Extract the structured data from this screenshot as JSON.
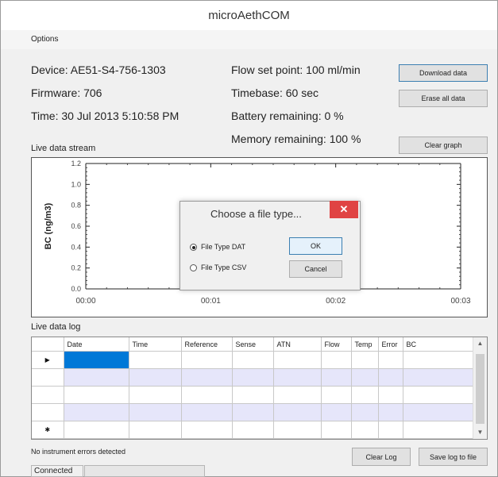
{
  "window": {
    "title": "microAethCOM"
  },
  "menu": {
    "options": "Options"
  },
  "info": {
    "device": "Device: AE51-S4-756-1303",
    "firmware": "Firmware: 706",
    "time": "Time: 30 Jul 2013 5:10:58 PM",
    "flow": "Flow set point: 100 ml/min",
    "timebase": "Timebase: 60 sec",
    "battery": "Battery remaining: 0 %",
    "memory": "Memory remaining: 100 %"
  },
  "buttons": {
    "download": "Download data",
    "erase": "Erase all data",
    "clear_graph": "Clear graph",
    "clear_log": "Clear Log",
    "save_log": "Save log to file"
  },
  "stream_label": "Live data stream",
  "chart_data": {
    "type": "line",
    "title": "",
    "xlabel": "",
    "ylabel": "BC (ng/m3)",
    "xlim": [
      0,
      3
    ],
    "ylim": [
      0,
      1.2
    ],
    "y_ticks": [
      "0.0",
      "0.2",
      "0.4",
      "0.6",
      "0.8",
      "1.0",
      "1.2"
    ],
    "x_ticks": [
      "00:00",
      "00:01",
      "00:02",
      "00:03"
    ],
    "series": []
  },
  "dialog": {
    "title": "Choose a file type...",
    "close": "✕",
    "option_dat": "File Type DAT",
    "option_csv": "File Type CSV",
    "selected": "dat",
    "ok": "OK",
    "cancel": "Cancel"
  },
  "log": {
    "label": "Live data log",
    "columns": [
      "Date",
      "Time",
      "Reference",
      "Sense",
      "ATN",
      "Flow",
      "Temp",
      "Error",
      "BC"
    ],
    "first_row_marker": "▶",
    "new_row_marker": "✱"
  },
  "status": {
    "errors": "No instrument errors detected",
    "connection": "Connected"
  }
}
